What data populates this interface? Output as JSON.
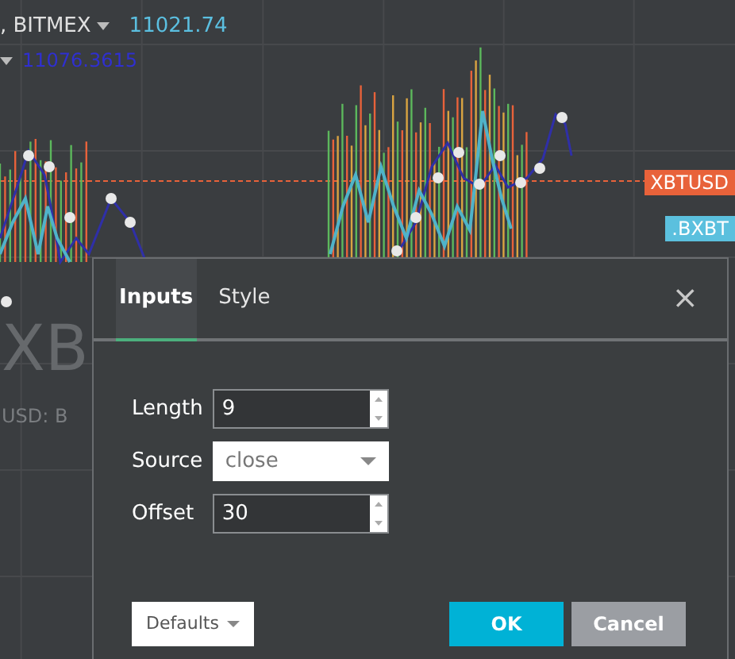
{
  "chart": {
    "legend": {
      "exchange": ", BITMEX",
      "price": "11021.74",
      "indicator_value": "11076.3615"
    },
    "watermark": [
      "XB",
      "USD: B"
    ],
    "price_labels": [
      {
        "text": "XBTUSD",
        "color": "#e8623a"
      },
      {
        "text": ".BXBT",
        "color": "#5bc0de"
      }
    ]
  },
  "dialog": {
    "tabs": [
      {
        "label": "Inputs",
        "selected": true
      },
      {
        "label": "Style",
        "selected": false
      }
    ],
    "close": "×",
    "inputs": [
      {
        "kind": "number",
        "label": "Length",
        "value": "9"
      },
      {
        "kind": "select",
        "label": "Source",
        "value": "close"
      },
      {
        "kind": "number",
        "label": "Offset",
        "value": "30"
      }
    ],
    "buttons": [
      {
        "kind": "menu",
        "label": "Defaults"
      },
      {
        "kind": "primary",
        "label": "OK"
      },
      {
        "kind": "secondary",
        "label": "Cancel"
      }
    ]
  }
}
